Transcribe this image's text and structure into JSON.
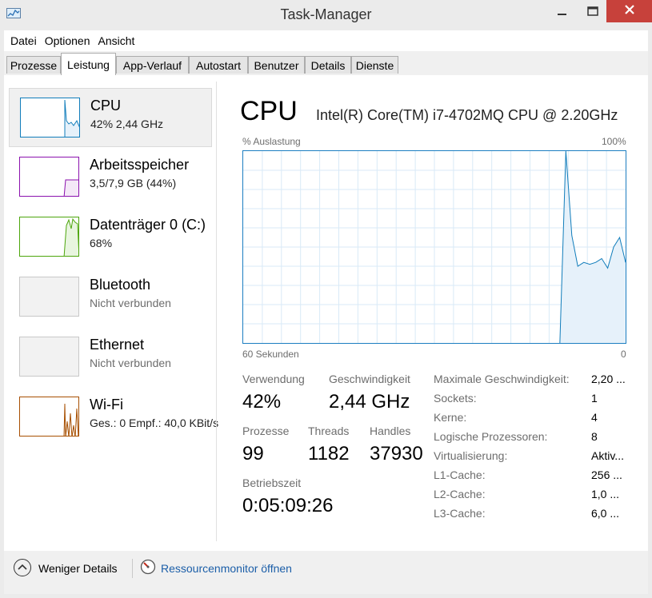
{
  "window": {
    "title": "Task-Manager",
    "icon": "task-manager-icon",
    "controls": [
      "minimize-icon",
      "maximize-icon",
      "close-icon"
    ],
    "close_color": "#c7413b"
  },
  "menu": [
    "Datei",
    "Optionen",
    "Ansicht"
  ],
  "tabs": [
    "Prozesse",
    "Leistung",
    "App-Verlauf",
    "Autostart",
    "Benutzer",
    "Details",
    "Dienste"
  ],
  "active_tab": "Leistung",
  "sidebar": [
    {
      "name": "CPU",
      "sub": "42%  2,44 GHz",
      "color": "#117dbb",
      "selected": true
    },
    {
      "name": "Arbeitsspeicher",
      "sub": "3,5/7,9 GB (44%)",
      "color": "#8b12ae",
      "selected": false
    },
    {
      "name": "Datenträger 0 (C:)",
      "sub": "68%",
      "color": "#4da60c",
      "selected": false
    },
    {
      "name": "Bluetooth",
      "sub": "Nicht verbunden",
      "color": "#a0a0a0",
      "selected": false
    },
    {
      "name": "Ethernet",
      "sub": "Nicht verbunden",
      "color": "#a0a0a0",
      "selected": false
    },
    {
      "name": "Wi-Fi",
      "sub": "Ges.: 0  Empf.: 40,0 KBit/s",
      "color": "#a74f01",
      "selected": false
    }
  ],
  "main": {
    "title": "CPU",
    "model": "Intel(R) Core(TM) i7-4702MQ CPU @ 2.20GHz",
    "graph_top_left": "% Auslastung",
    "graph_top_right": "100%",
    "graph_bottom_left": "60 Sekunden",
    "graph_bottom_right": "0",
    "graph_color": "#117dbb"
  },
  "chart_data": {
    "type": "area",
    "ylim": [
      0,
      100
    ],
    "grid": true,
    "values": [
      0,
      0,
      0,
      0,
      0,
      0,
      0,
      0,
      0,
      0,
      0,
      0,
      0,
      0,
      0,
      0,
      0,
      0,
      0,
      0,
      0,
      0,
      0,
      0,
      0,
      0,
      0,
      0,
      0,
      0,
      0,
      0,
      0,
      0,
      0,
      0,
      0,
      0,
      0,
      0,
      0,
      0,
      0,
      0,
      0,
      0,
      0,
      0,
      0,
      0,
      0,
      0,
      0,
      0,
      100,
      56,
      40,
      42,
      41,
      42,
      44,
      39,
      50,
      55,
      42
    ]
  },
  "stats": {
    "verwendung_label": "Verwendung",
    "verwendung": "42%",
    "geschwindigkeit_label": "Geschwindigkeit",
    "geschwindigkeit": "2,44 GHz",
    "prozesse_label": "Prozesse",
    "prozesse": "99",
    "threads_label": "Threads",
    "threads": "1182",
    "handles_label": "Handles",
    "handles": "37930",
    "betriebszeit_label": "Betriebszeit",
    "betriebszeit": "0:05:09:26"
  },
  "specs": [
    {
      "label": "Maximale Geschwindigkeit:",
      "value": "2,20 ..."
    },
    {
      "label": "Sockets:",
      "value": "1"
    },
    {
      "label": "Kerne:",
      "value": "4"
    },
    {
      "label": "Logische Prozessoren:",
      "value": "8"
    },
    {
      "label": "Virtualisierung:",
      "value": "Aktiv..."
    },
    {
      "label": "L1-Cache:",
      "value": "256 ..."
    },
    {
      "label": "L2-Cache:",
      "value": "1,0 ..."
    },
    {
      "label": "L3-Cache:",
      "value": "6,0 ..."
    }
  ],
  "footer": {
    "less_details": "Weniger Details",
    "resource_monitor": "Ressourcenmonitor öffnen"
  }
}
